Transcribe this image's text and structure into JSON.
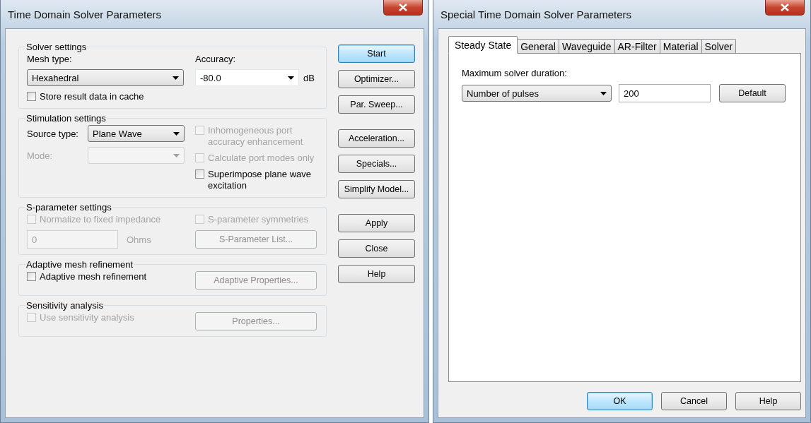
{
  "main_window": {
    "title": "Time Domain Solver Parameters",
    "groups": [
      {
        "title": "Solver settings",
        "left": [
          {
            "kind": "label",
            "text": "Mesh type:",
            "disabled": false
          },
          {
            "kind": "select",
            "value": "Hexahedral",
            "disabled": false
          },
          {
            "kind": "checkbox",
            "text": "Store result data in cache",
            "checked": false,
            "disabled": false
          }
        ],
        "right": [
          {
            "kind": "label",
            "text": "Accuracy:",
            "disabled": false
          },
          {
            "kind": "combo",
            "value": "-80.0",
            "unit": "dB",
            "disabled": false
          }
        ]
      },
      {
        "title": "Stimulation settings",
        "left": [
          {
            "kind": "labeled-select",
            "text": "Source type:",
            "value": "Plane Wave",
            "disabled": false
          },
          {
            "kind": "labeled-select",
            "text": "Mode:",
            "disabled": true
          }
        ],
        "right": [
          {
            "kind": "checkbox",
            "text": "Inhomogeneous port accuracy enhancement",
            "checked": false,
            "disabled": true
          },
          {
            "kind": "checkbox",
            "text": "Calculate port modes only",
            "checked": false,
            "disabled": true
          },
          {
            "kind": "checkbox",
            "text": "Superimpose plane wave excitation",
            "checked": false,
            "disabled": false
          }
        ]
      },
      {
        "title": "S-parameter settings",
        "left": [
          {
            "kind": "checkbox",
            "text": "Normalize to fixed impedance",
            "checked": false,
            "disabled": true
          },
          {
            "kind": "input",
            "value": "0",
            "unit": "Ohms",
            "disabled": true
          }
        ],
        "right": [
          {
            "kind": "checkbox",
            "text": "S-parameter symmetries",
            "checked": false,
            "disabled": true
          },
          {
            "kind": "button",
            "text": "S-Parameter List...",
            "disabled": true
          }
        ]
      },
      {
        "title": "Adaptive mesh refinement",
        "left": [
          {
            "kind": "checkbox",
            "text": "Adaptive mesh refinement",
            "checked": false,
            "disabled": false
          }
        ],
        "right": [
          {
            "kind": "button",
            "text": "Adaptive Properties...",
            "disabled": true
          }
        ]
      },
      {
        "title": "Sensitivity analysis",
        "left": [
          {
            "kind": "checkbox",
            "text": "Use sensitivity analysis",
            "checked": false,
            "disabled": true
          }
        ],
        "right": [
          {
            "kind": "button",
            "text": "Properties...",
            "disabled": true
          }
        ]
      }
    ],
    "button_groups": [
      [
        {
          "label": "Start",
          "default": true
        },
        {
          "label": "Optimizer...",
          "default": false
        },
        {
          "label": "Par. Sweep...",
          "default": false
        }
      ],
      [
        {
          "label": "Acceleration...",
          "default": false
        },
        {
          "label": "Specials...",
          "default": false
        },
        {
          "label": "Simplify Model...",
          "default": false
        }
      ],
      [
        {
          "label": "Apply",
          "default": false
        },
        {
          "label": "Close",
          "default": false
        },
        {
          "label": "Help",
          "default": false
        }
      ]
    ]
  },
  "special_window": {
    "title": "Special Time Domain Solver Parameters",
    "tabs": [
      {
        "label": "Steady State",
        "selected": true
      },
      {
        "label": "General",
        "selected": false
      },
      {
        "label": "Waveguide",
        "selected": false
      },
      {
        "label": "AR-Filter",
        "selected": false
      },
      {
        "label": "Material",
        "selected": false
      },
      {
        "label": "Solver",
        "selected": false
      }
    ],
    "duration_label": "Maximum solver duration:",
    "duration_type": "Number of pulses",
    "duration_value": "200",
    "default_button": "Default",
    "buttons": [
      {
        "label": "OK",
        "default": true
      },
      {
        "label": "Cancel",
        "default": false
      },
      {
        "label": "Help",
        "default": false
      }
    ]
  }
}
